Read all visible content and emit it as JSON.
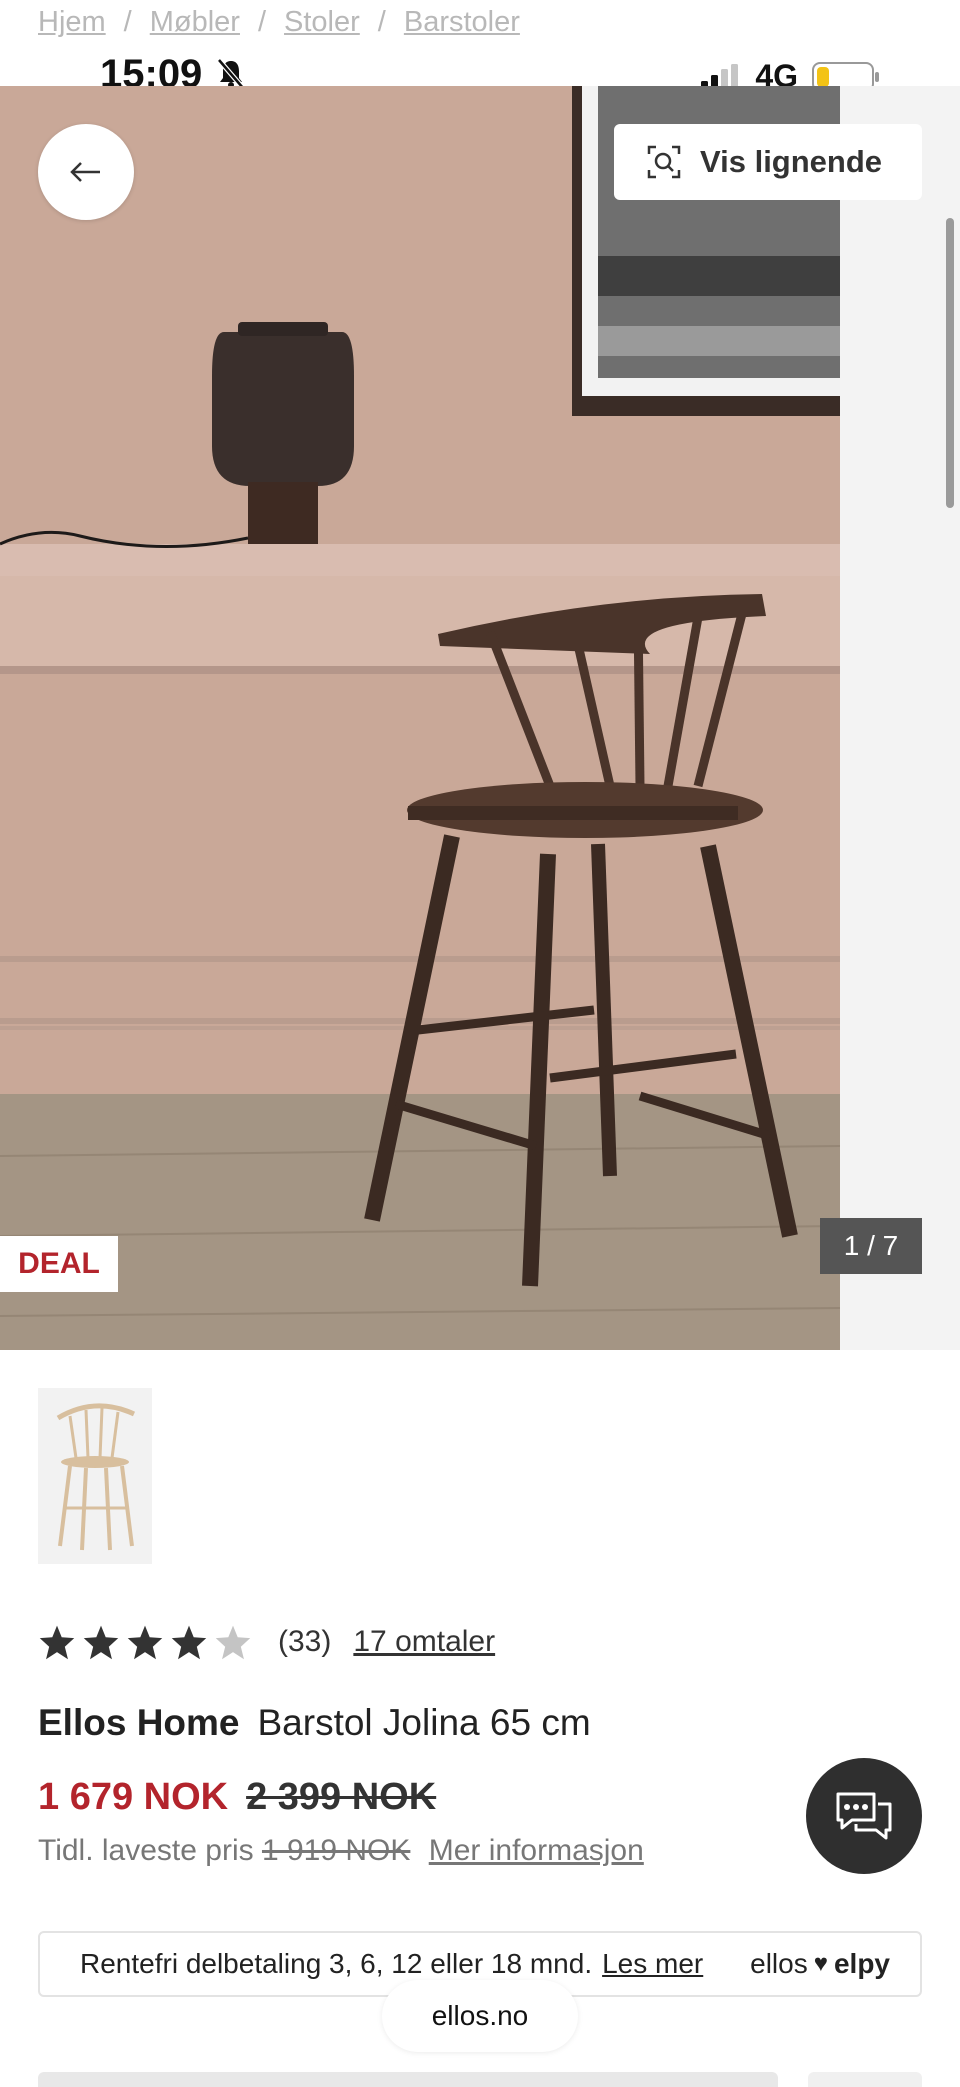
{
  "breadcrumb": [
    "Hjem",
    "Møbler",
    "Stoler",
    "Barstoler"
  ],
  "status": {
    "time": "15:09",
    "network": "4G"
  },
  "gallery": {
    "similar_label": "Vis lignende",
    "deal_label": "DEAL",
    "counter": "1 / 7"
  },
  "rating": {
    "stars": 4,
    "max": 5,
    "count": "(33)",
    "reviews_link": "17 omtaler"
  },
  "product": {
    "brand": "Ellos Home",
    "name": "Barstol Jolina 65 cm"
  },
  "price": {
    "current": "1 679 NOK",
    "original": "2 399 NOK",
    "lowest_prefix": "Tidl. laveste pris",
    "lowest_value": "1 919 NOK",
    "more_info": "Mer informasjon"
  },
  "installment": {
    "text": "Rentefri delbetaling 3, 6, 12 eller 18 mnd.",
    "link": "Les mer",
    "logo_left": "ellos",
    "logo_right": "elpy"
  },
  "browser": {
    "url": "ellos.no"
  },
  "colors": {
    "accent_red": "#b3242c",
    "dark": "#2f2f2f"
  }
}
